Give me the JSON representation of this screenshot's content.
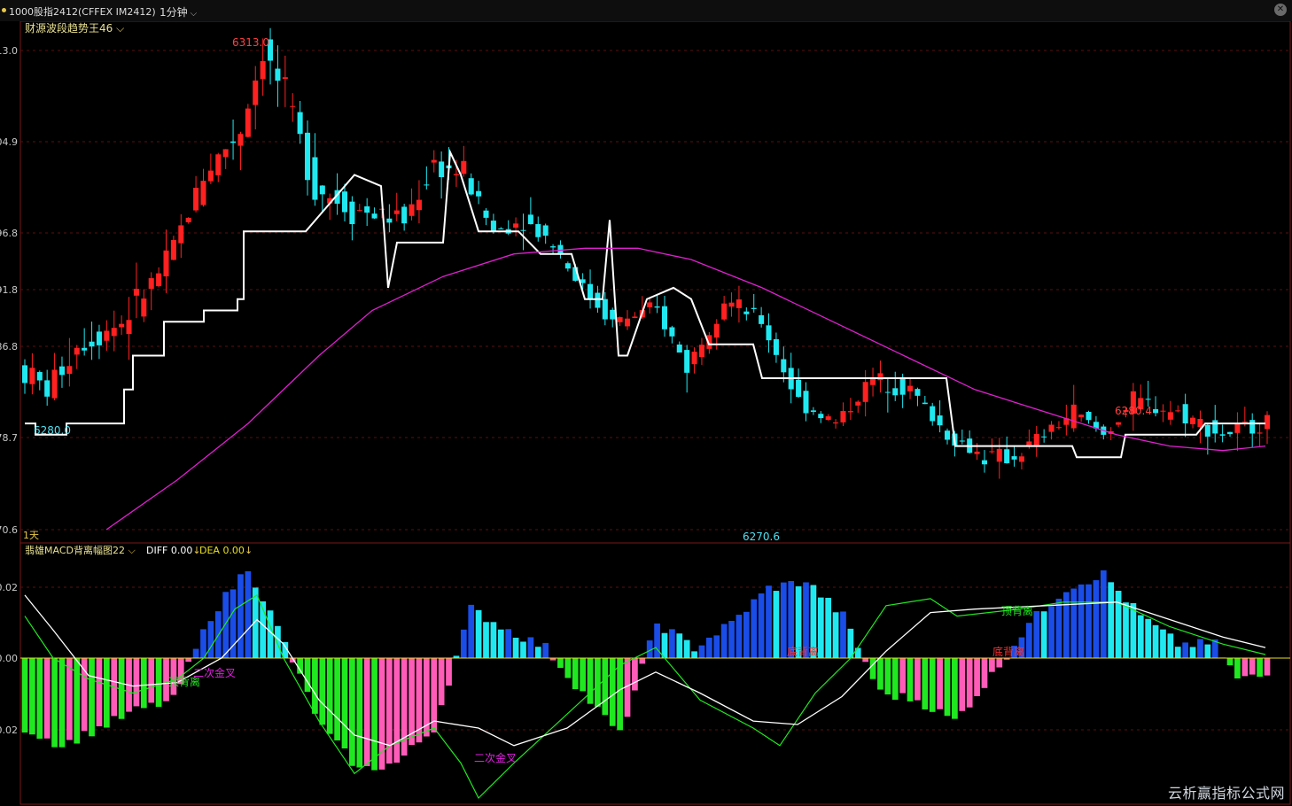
{
  "window": {
    "symbol_label": "1000股指2412(CFFEX IM2412)",
    "period_label": "1分钟",
    "close_icon": "close-icon"
  },
  "watermark": "云析赢指标公式网",
  "chart_data": [
    {
      "type": "candlestick",
      "indicator_label": "财源波段趋势王46",
      "y_tick_labels": [
        "13.0",
        "04.9",
        "96.8",
        "91.8",
        "86.8",
        "78.7",
        "70.6"
      ],
      "y_axis": [
        {
          "value": 6313.0,
          "label": "13.0"
        },
        {
          "value": 6304.9,
          "label": "04.9"
        },
        {
          "value": 6296.8,
          "label": "96.8"
        },
        {
          "value": 6291.8,
          "label": "91.8"
        },
        {
          "value": 6286.8,
          "label": "86.8"
        },
        {
          "value": 6278.7,
          "label": "78.7"
        },
        {
          "value": 6270.6,
          "label": "70.6"
        }
      ],
      "ylim": [
        6270.6,
        6313.0
      ],
      "period_tag": "1天",
      "annotations": [
        {
          "text": "6313.0",
          "value": 6313.0,
          "color": "#ff4040"
        },
        {
          "text": "6280.0",
          "value": 6280.0,
          "color": "#4fe0f0"
        },
        {
          "text": "6270.6",
          "value": 6270.6,
          "color": "#4fe0f0"
        },
        {
          "text": "6280.4",
          "value": 6280.4,
          "color": "#ff4040"
        }
      ],
      "series": [
        {
          "name": "趋势线",
          "color": "#ffffff"
        },
        {
          "name": "均线",
          "color": "#e020d0"
        }
      ],
      "colors": {
        "up": "#ff2020",
        "down": "#20e8f0",
        "trend": "#ffffff",
        "ma": "#e020d0"
      }
    },
    {
      "type": "macd",
      "indicator_label": "翡雄MACD背离幅图22",
      "diff_label": "DIFF 0.00",
      "dea_label": "DEA 0.00",
      "diff_arrow": "↓",
      "dea_arrow": "↓",
      "y_tick_labels": [
        "0.02",
        "0.00",
        "-0.02"
      ],
      "y_axis": [
        {
          "value": 0.02,
          "label": "0.02"
        },
        {
          "value": 0.0,
          "label": "0.00"
        },
        {
          "value": -0.02,
          "label": "-0.02"
        }
      ],
      "ylim": [
        -0.045,
        0.03
      ],
      "annotations": [
        {
          "text": "顶背离",
          "color": "#20e820"
        },
        {
          "text": "二次金叉",
          "color": "#e020e0"
        },
        {
          "text": "二次金叉",
          "color": "#e020e0"
        },
        {
          "text": "底背离",
          "color": "#ff3030"
        },
        {
          "text": "顶背离",
          "color": "#20e820"
        },
        {
          "text": "底背离",
          "color": "#ff3030"
        }
      ],
      "colors": {
        "diff": "#ffffff",
        "dea_up": "#ff2020",
        "dea_down": "#20e820",
        "bar_pos_strong": "#1a4de8",
        "bar_pos_weak": "#20e8f0",
        "bar_neg_strong": "#20e820",
        "bar_neg_weak": "#ff5cb8",
        "zero_line": "#e8e020"
      }
    }
  ]
}
